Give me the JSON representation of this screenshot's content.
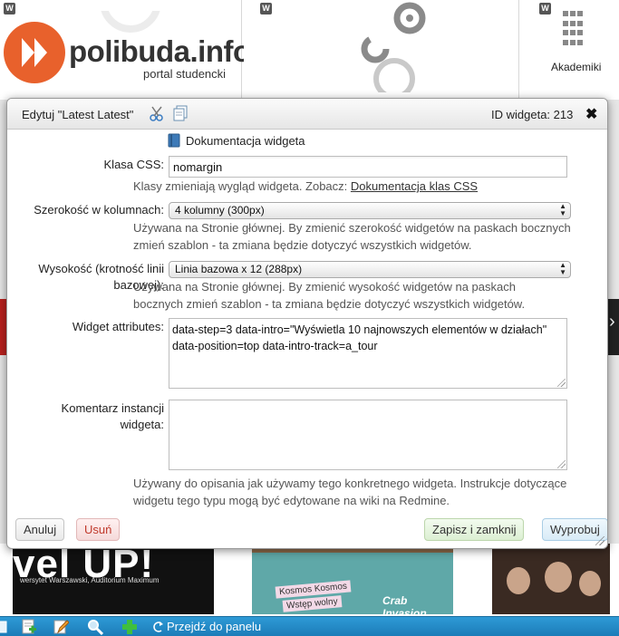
{
  "page": {
    "header": {
      "widget_badge": "W",
      "logo_text": "polibuda.info",
      "logo_subtitle": "portal studencki",
      "akademiki_label": "Akademiki"
    },
    "banners": {
      "banner1_big": "vel UP!",
      "banner1_small": "wersytet Warszawski, Auditorium Maximum",
      "banner2_tag1": "Kosmos Kosmos",
      "banner2_tag2": "Wstęp wolny",
      "banner2_title": "Crab Invasion"
    },
    "toolbar": {
      "panel_link": "Przejdź do panelu"
    }
  },
  "dialog": {
    "title": "Edytuj \"Latest Latest\"",
    "widget_id": "ID widgeta: 213",
    "close_label": "✖",
    "doc_link": "Dokumentacja widgeta",
    "css_class": {
      "label": "Klasa CSS:",
      "value": "nomargin",
      "help": "Klasy zmieniają wygląd widgeta. Zobacz:",
      "help_link": "Dokumentacja klas CSS"
    },
    "width": {
      "label": "Szerokość w kolumnach:",
      "selected": "4 kolumny (300px)",
      "help_line1": "Używana na Stronie głównej. By zmienić szerokość widgetów na paskach bocznych",
      "help_line2": "zmień szablon - ta zmiana będzie dotyczyć wszystkich widgetów."
    },
    "height": {
      "label_line1": "Wysokość (krotność linii",
      "label_line2": "bazowej):",
      "selected": "Linia bazowa x 12 (288px)",
      "help_line1": "Używana na Stronie głównej. By zmienić wysokość widgetów na paskach",
      "help_line2": "bocznych zmień szablon - ta zmiana będzie dotyczyć wszystkich widgetów."
    },
    "attributes": {
      "label": "Widget attributes:",
      "value_line1": "data-step=3 data-intro=\"Wyświetla 10 najnowszych elementów w działach\"",
      "value_line2": "data-position=top data-intro-track=a_tour"
    },
    "comment": {
      "label_line1": "Komentarz instancji",
      "label_line2": "widgeta:",
      "value": "",
      "help_line1": "Używany do opisania jak używamy tego konkretnego widgeta. Instrukcje dotyczące",
      "help_line2": "widgetu tego typu mogą być edytowane na wiki na Redmine."
    },
    "buttons": {
      "cancel": "Anuluj",
      "delete": "Usuń",
      "save_close": "Zapisz i zamknij",
      "preview": "Wyprobuj"
    }
  },
  "colors": {
    "accent_orange": "#e8612c",
    "toolbar_blue": "#1c7cb8",
    "delete_red": "#c0392b"
  }
}
